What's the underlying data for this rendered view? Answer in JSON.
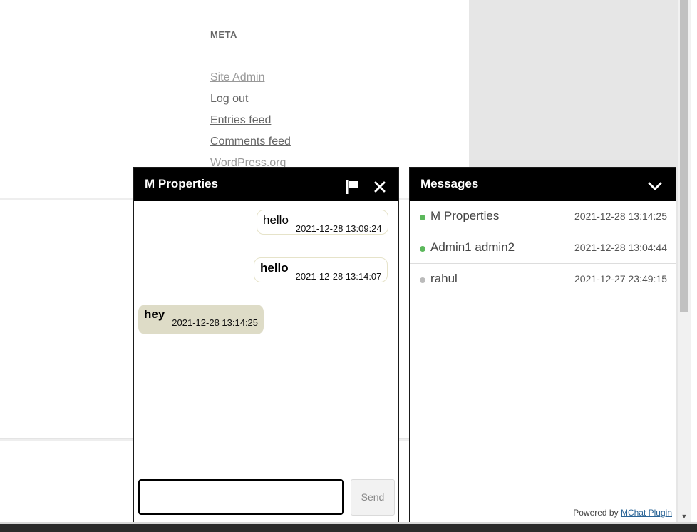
{
  "sidebar_meta": {
    "title": "META",
    "links": [
      {
        "label": "Site Admin"
      },
      {
        "label": "Log out"
      },
      {
        "label": "Entries feed"
      },
      {
        "label": "Comments feed"
      },
      {
        "label": "WordPress.org"
      }
    ]
  },
  "chat": {
    "title": "M Properties",
    "icons": {
      "flag": "flag-icon",
      "close": "close-icon"
    },
    "messages": [
      {
        "text": "hello",
        "time": "2021-12-28 13:09:24",
        "direction": "out",
        "bold": false
      },
      {
        "text": "hello",
        "time": "2021-12-28 13:14:07",
        "direction": "out",
        "bold": true
      },
      {
        "text": "hey",
        "time": "2021-12-28 13:14:25",
        "direction": "in",
        "bold": true
      }
    ],
    "input": {
      "value": "",
      "placeholder": ""
    },
    "send_label": "Send"
  },
  "messages_panel": {
    "title": "Messages",
    "toggle_icon": "chevron-down-icon",
    "conversations": [
      {
        "name": "M Properties",
        "time": "2021-12-28 13:14:25",
        "status": "online"
      },
      {
        "name": "Admin1 admin2",
        "time": "2021-12-28 13:04:44",
        "status": "online"
      },
      {
        "name": "rahul",
        "time": "2021-12-27 23:49:15",
        "status": "offline"
      }
    ],
    "powered_by": {
      "prefix": "Powered by",
      "link_label": "MChat Plugin"
    }
  },
  "colors": {
    "header_bg": "#000000",
    "online_dot": "#5cb85c",
    "offline_dot": "#bbbbbb",
    "incoming_bubble": "#dedcc7",
    "outgoing_bubble_border": "#e6e3c9",
    "link": "#2a6496"
  }
}
